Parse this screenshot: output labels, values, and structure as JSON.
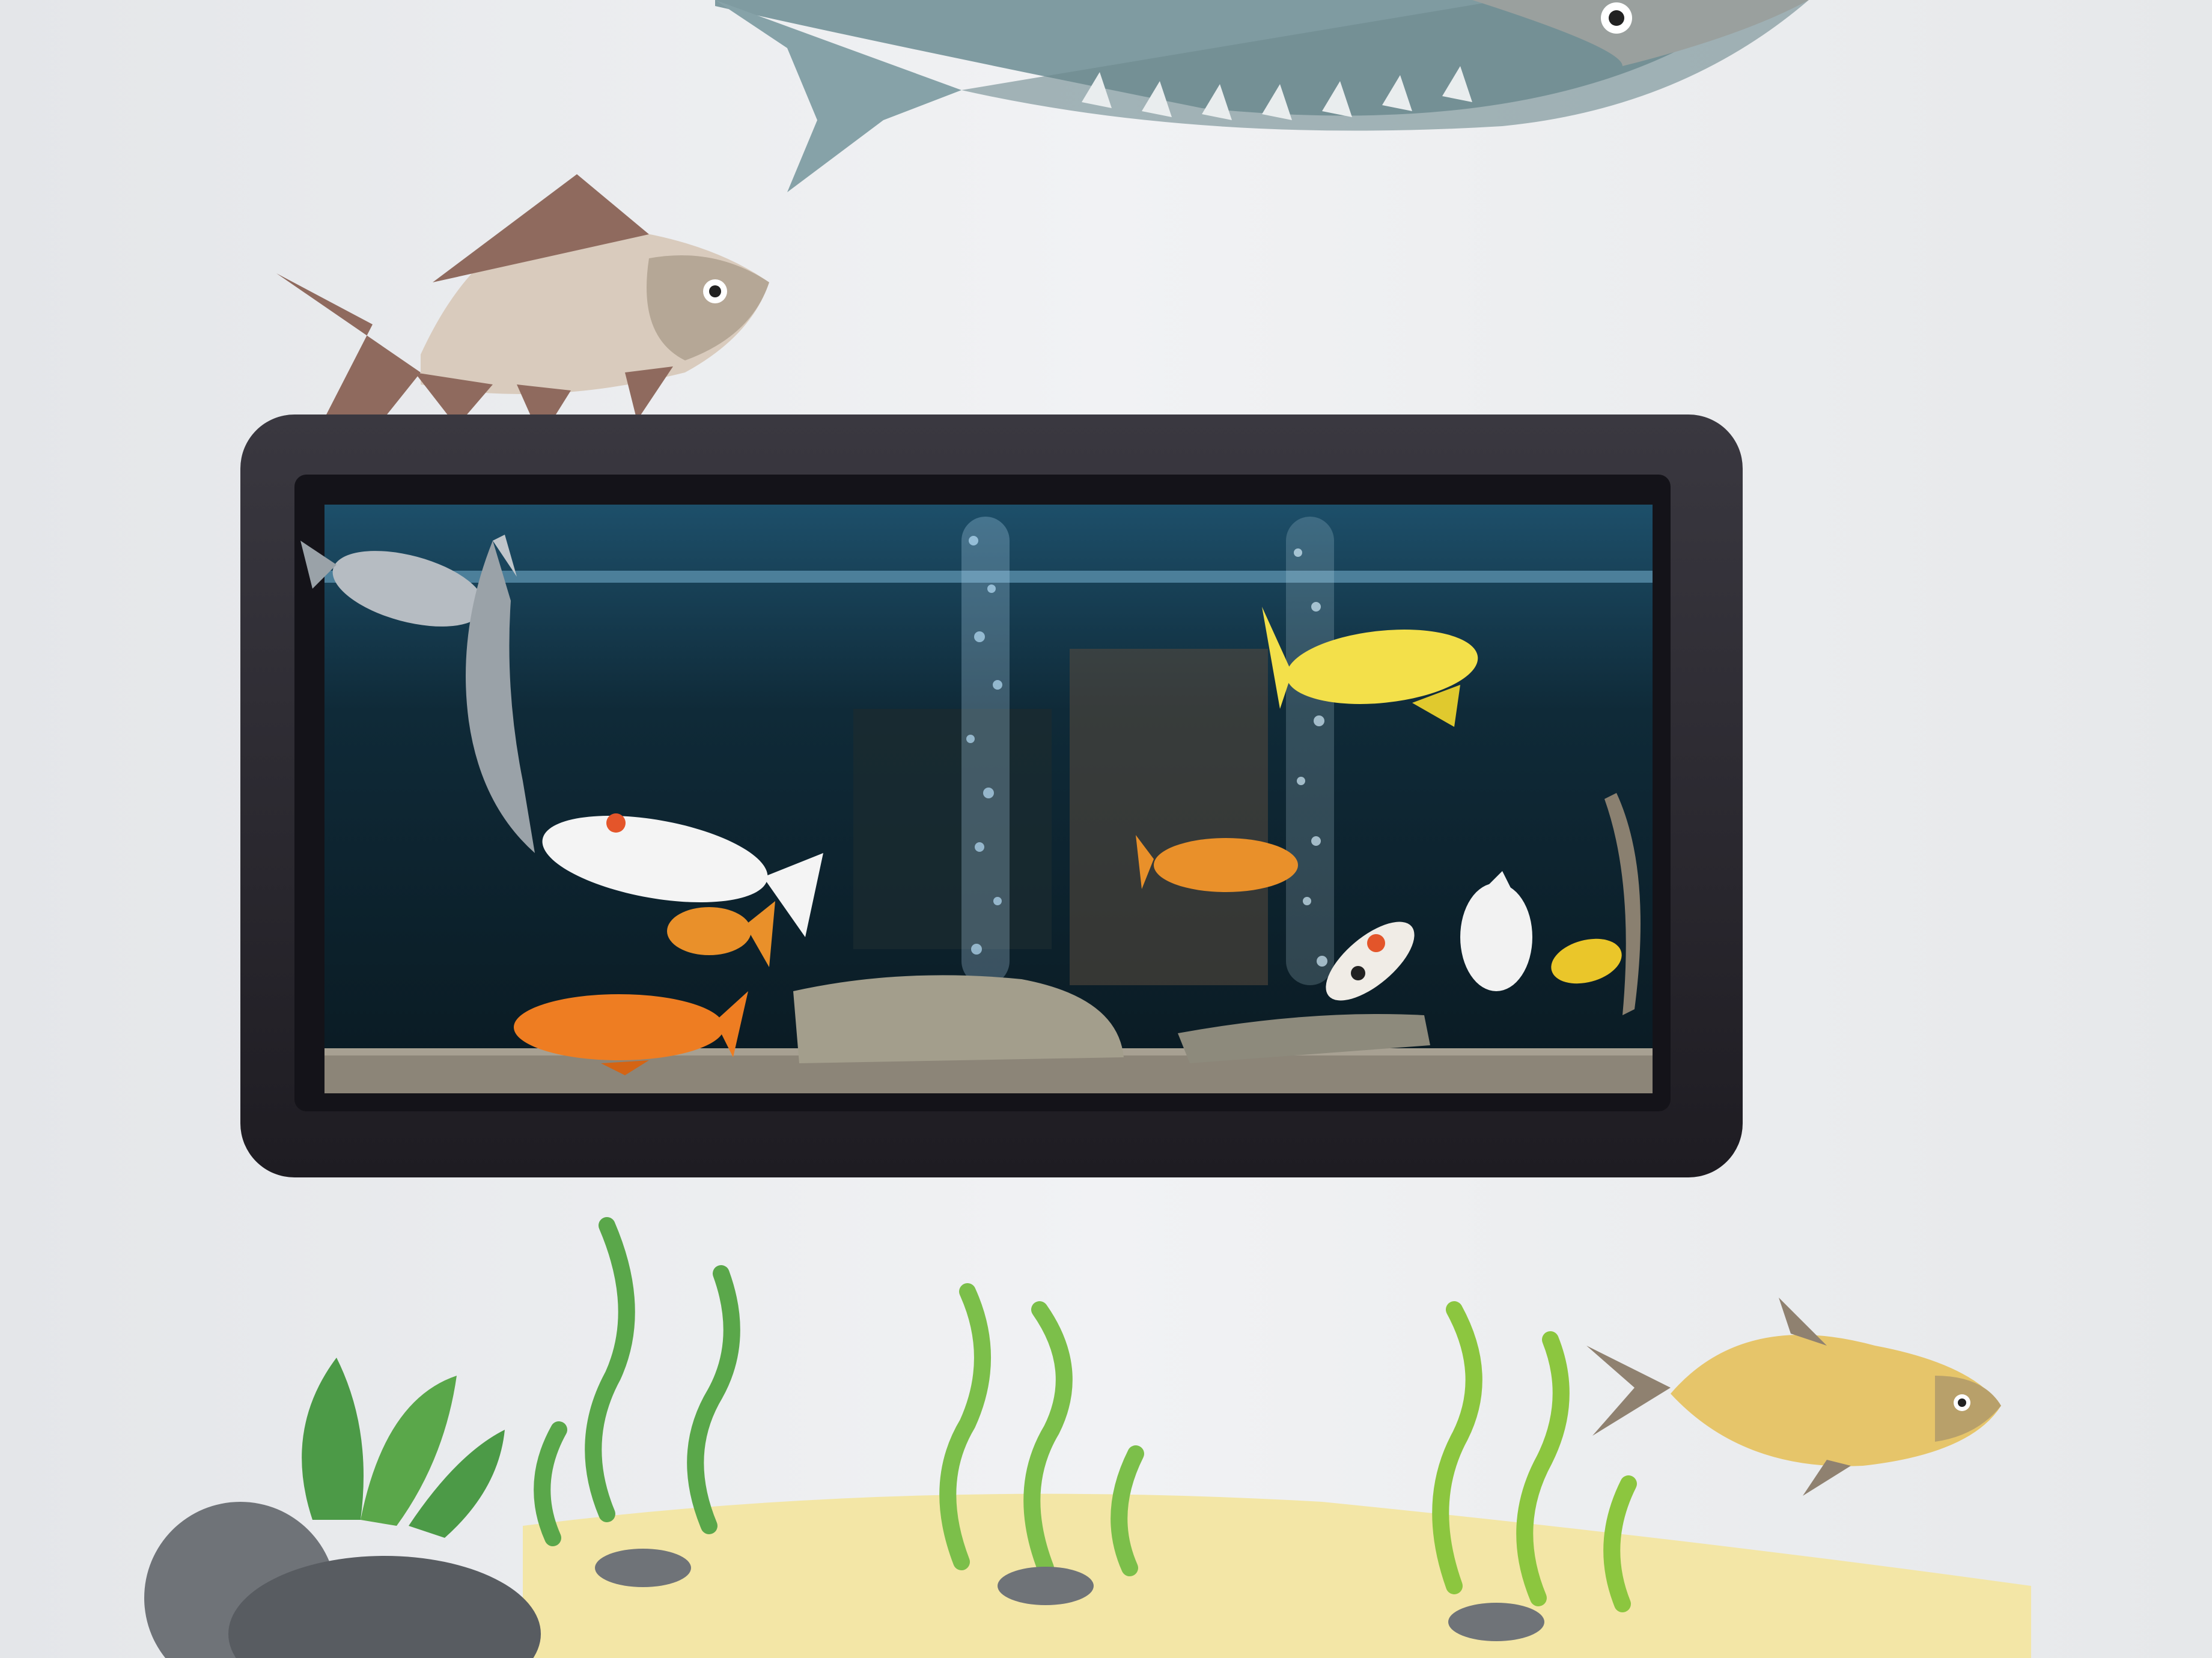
{
  "scene": {
    "wall_color": "#eef0f2",
    "sand_color": "#f3e6a6",
    "frame_color": "#2a2830",
    "water_color": "#0d2330",
    "gravel_color": "#8c8578",
    "weed_color": "#8cc63f",
    "weed_dark": "#4c9a47",
    "rock_color": "#6f7378"
  },
  "decor": [
    {
      "name": "sturgeon-cutout",
      "color": "#7e9aa0"
    },
    {
      "name": "carp-cutout",
      "color": "#d8c6b4"
    },
    {
      "name": "bream-cutout",
      "color": "#e6c56a"
    }
  ],
  "tank_fish": [
    {
      "name": "white-red-koi",
      "color": "#f4f4f4"
    },
    {
      "name": "orange-koi",
      "color": "#ee7d22"
    },
    {
      "name": "yellow-koi",
      "color": "#f3e04a"
    },
    {
      "name": "small-orange-koi",
      "color": "#e9902a"
    },
    {
      "name": "gray-koi",
      "color": "#b6bcc2"
    },
    {
      "name": "white-koi",
      "color": "#f2f2f2"
    },
    {
      "name": "calico-koi",
      "color": "#f0ece6"
    },
    {
      "name": "small-yellow-koi",
      "color": "#eac62a"
    },
    {
      "name": "sturgeon-fish",
      "color": "#9aa2a8"
    }
  ]
}
